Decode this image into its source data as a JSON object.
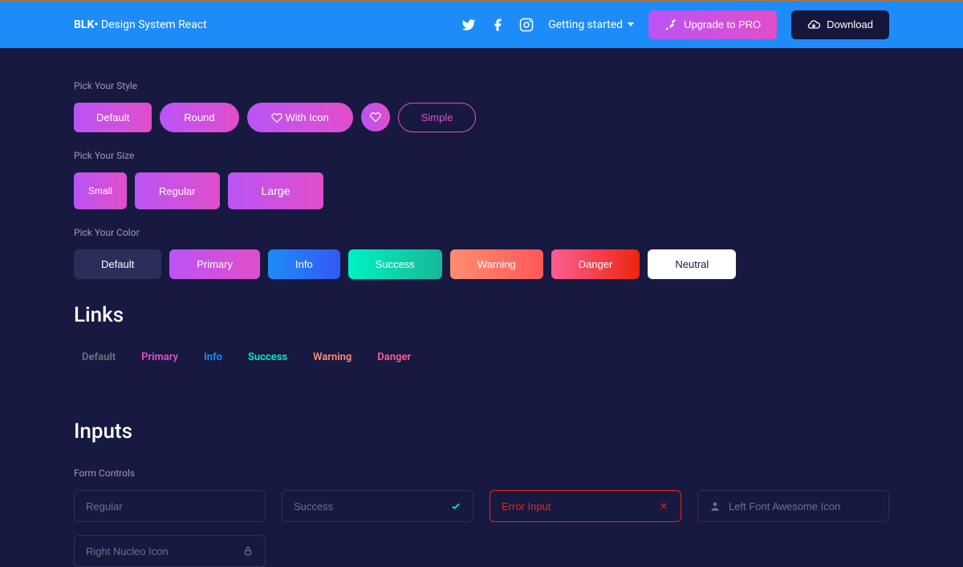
{
  "navbar": {
    "brand_bold": "BLK•",
    "brand_rest": " Design System React",
    "getting_started": "Getting started",
    "upgrade": "Upgrade to PRO",
    "download": "Download"
  },
  "style_section": {
    "label": "Pick Your Style",
    "default": "Default",
    "round": "Round",
    "with_icon": "With Icon",
    "simple": "Simple"
  },
  "size_section": {
    "label": "Pick Your Size",
    "small": "Small",
    "regular": "Regular",
    "large": "Large"
  },
  "color_section": {
    "label": "Pick Your Color",
    "default": "Default",
    "primary": "Primary",
    "info": "Info",
    "success": "Success",
    "warning": "Warning",
    "danger": "Danger",
    "neutral": "Neutral"
  },
  "links": {
    "title": "Links",
    "default": "Default",
    "primary": "Primary",
    "info": "Info",
    "success": "Success",
    "warning": "Warning",
    "danger": "Danger"
  },
  "inputs": {
    "title": "Inputs",
    "label": "Form Controls",
    "regular": "Regular",
    "success": "Success",
    "error": "Error Input",
    "left_icon": "Left Font Awesome Icon",
    "right_icon": "Right Nucleo Icon"
  }
}
